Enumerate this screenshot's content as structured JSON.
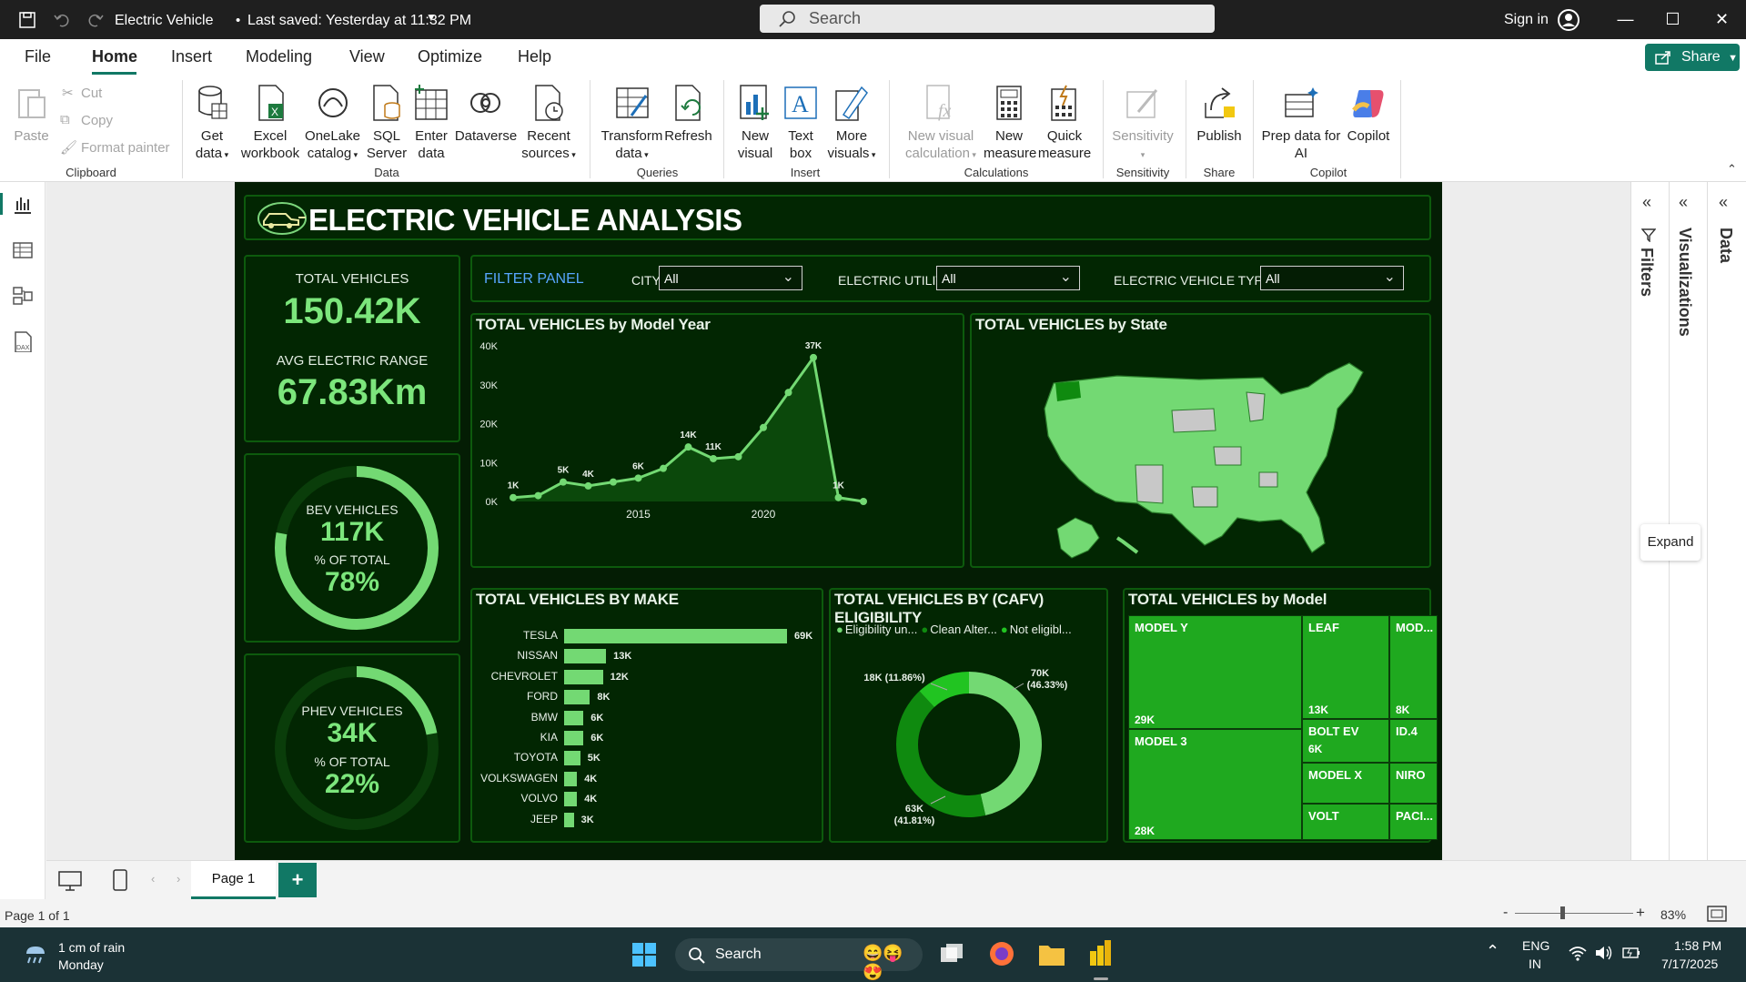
{
  "titlebar": {
    "title": "Electric Vehicle",
    "saved": "Last saved: Yesterday at 11:32 PM",
    "search_placeholder": "Search",
    "sign_in": "Sign in"
  },
  "menu": {
    "items": [
      "File",
      "Home",
      "Insert",
      "Modeling",
      "View",
      "Optimize",
      "Help"
    ],
    "active": "Home",
    "share": "Share"
  },
  "ribbon": {
    "clipboard": {
      "paste": "Paste",
      "cut": "Cut",
      "copy": "Copy",
      "format_painter": "Format painter",
      "group": "Clipboard"
    },
    "data": {
      "get_data": "Get data",
      "excel": "Excel workbook",
      "onelake": "OneLake catalog",
      "sql": "SQL Server",
      "enter": "Enter data",
      "dataverse": "Dataverse",
      "recent": "Recent sources",
      "group": "Data"
    },
    "queries": {
      "transform": "Transform data",
      "refresh": "Refresh",
      "group": "Queries"
    },
    "insert": {
      "new_visual": "New visual",
      "text_box": "Text box",
      "more_visuals": "More visuals",
      "group": "Insert"
    },
    "calculations": {
      "new_visual_calc": "New visual calculation",
      "new_measure": "New measure",
      "quick_measure": "Quick measure",
      "group": "Calculations"
    },
    "sensitivity": {
      "label": "Sensitivity",
      "group": "Sensitivity"
    },
    "share": {
      "publish": "Publish",
      "group": "Share"
    },
    "copilot": {
      "prep": "Prep data for AI",
      "copilot": "Copilot",
      "group": "Copilot"
    }
  },
  "report": {
    "title": "ELECTRIC VEHICLE ANALYSIS",
    "kpi1": {
      "total_label": "TOTAL VEHICLES",
      "total_value": "150.42K",
      "range_label": "AVG ELECTRIC RANGE",
      "range_value": "67.83Km"
    },
    "bev": {
      "label": "BEV VEHICLES",
      "value": "117K",
      "pct_label": "% OF TOTAL",
      "pct": "78%",
      "pct_num": 78
    },
    "phev": {
      "label": "PHEV VEHICLES",
      "value": "34K",
      "pct_label": "% OF TOTAL",
      "pct": "22%",
      "pct_num": 22
    },
    "filters": {
      "title": "FILTER PANEL",
      "city_label": "CITY",
      "city_value": "All",
      "utility_label": "ELECTRIC UTILITY",
      "utility_value": "All",
      "type_label": "ELECTRIC VEHICLE TYPE",
      "type_value": "All"
    },
    "line_title": "TOTAL VEHICLES by Model Year",
    "map_title": "TOTAL VEHICLES by State",
    "make_title": "TOTAL VEHICLES BY MAKE",
    "cafv_title": "TOTAL VEHICLES BY (CAFV) ELIGIBILITY",
    "model_title": "TOTAL VEHICLES by Model"
  },
  "chart_data": [
    {
      "type": "area",
      "title": "TOTAL VEHICLES by Model Year",
      "xlabel": "",
      "ylabel": "",
      "x": [
        2010,
        2011,
        2012,
        2013,
        2014,
        2015,
        2016,
        2017,
        2018,
        2019,
        2020,
        2021,
        2022,
        2023,
        2024
      ],
      "values": [
        1000,
        1500,
        5000,
        4000,
        5000,
        6000,
        8500,
        14000,
        11000,
        11500,
        19000,
        28000,
        37000,
        1000,
        0
      ],
      "data_labels": [
        {
          "x": 2010,
          "text": "1K"
        },
        {
          "x": 2012,
          "text": "5K"
        },
        {
          "x": 2013,
          "text": "4K"
        },
        {
          "x": 2015,
          "text": "6K"
        },
        {
          "x": 2017,
          "text": "14K"
        },
        {
          "x": 2018,
          "text": "11K"
        },
        {
          "x": 2022,
          "text": "37K"
        },
        {
          "x": 2023,
          "text": "1K"
        }
      ],
      "ylim": [
        0,
        40000
      ],
      "yticks": [
        "0K",
        "10K",
        "20K",
        "30K",
        "40K"
      ],
      "xticks": [
        "2015",
        "2020"
      ],
      "color": "#73d973"
    },
    {
      "type": "bar",
      "title": "TOTAL VEHICLES BY MAKE",
      "categories": [
        "TESLA",
        "NISSAN",
        "CHEVROLET",
        "FORD",
        "BMW",
        "KIA",
        "TOYOTA",
        "VOLKSWAGEN",
        "VOLVO",
        "JEEP"
      ],
      "values": [
        69,
        13,
        12,
        8,
        6,
        6,
        5,
        4,
        4,
        3
      ],
      "labels": [
        "69K",
        "13K",
        "12K",
        "8K",
        "6K",
        "6K",
        "5K",
        "4K",
        "4K",
        "3K"
      ],
      "color": "#73d973"
    },
    {
      "type": "pie",
      "title": "TOTAL VEHICLES BY (CAFV) ELIGIBILITY",
      "legend": [
        "Eligibility un...",
        "Clean Alter...",
        "Not eligibl..."
      ],
      "slices": [
        {
          "name": "Eligibility un...",
          "value": 70,
          "label": "70K",
          "pct": "(46.33%)",
          "color": "#73d973"
        },
        {
          "name": "Clean Alter...",
          "value": 63,
          "label": "63K",
          "pct": "(41.81%)",
          "color": "#0f8a0f"
        },
        {
          "name": "Not eligibl...",
          "value": 18,
          "label": "18K (11.86%)",
          "color": "#21c421"
        }
      ]
    },
    {
      "type": "treemap",
      "title": "TOTAL VEHICLES by Model",
      "items": [
        {
          "name": "MODEL Y",
          "value": "29K"
        },
        {
          "name": "MODEL 3",
          "value": "28K"
        },
        {
          "name": "LEAF",
          "value": "13K"
        },
        {
          "name": "MOD...",
          "value": "8K"
        },
        {
          "name": "BOLT EV",
          "value": "6K"
        },
        {
          "name": "ID.4",
          "value": ""
        },
        {
          "name": "MODEL X",
          "value": ""
        },
        {
          "name": "NIRO",
          "value": ""
        },
        {
          "name": "VOLT",
          "value": ""
        },
        {
          "name": "PACI...",
          "value": ""
        }
      ]
    }
  ],
  "rightpanes": {
    "filters": "Filters",
    "visualizations": "Visualizations",
    "data": "Data",
    "expand_tooltip": "Expand"
  },
  "pages": {
    "tab": "Page 1",
    "status": "Page 1 of 1",
    "zoom": "83%"
  },
  "taskbar": {
    "weather": "1 cm of rain",
    "day": "Monday",
    "search": "Search",
    "lang1": "ENG",
    "lang2": "IN",
    "time": "1:58 PM",
    "date": "7/17/2025"
  }
}
